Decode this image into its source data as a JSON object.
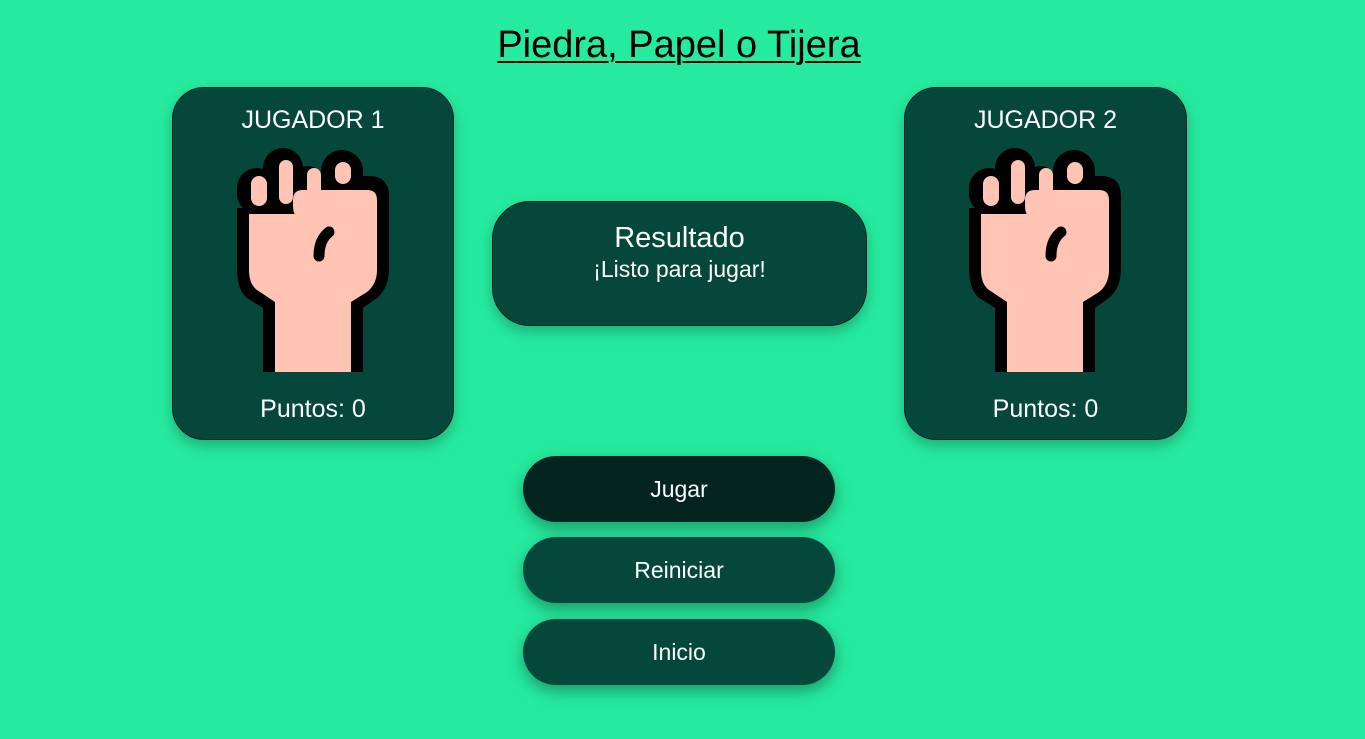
{
  "title": "Piedra, Papel o Tijera",
  "players": [
    {
      "name": "JUGADOR 1",
      "score_text": "Puntos: 0",
      "choice_icon": "fist-icon"
    },
    {
      "name": "JUGADOR 2",
      "score_text": "Puntos: 0",
      "choice_icon": "fist-icon"
    }
  ],
  "result": {
    "title": "Resultado",
    "message": "¡Listo para jugar!"
  },
  "buttons": {
    "play": "Jugar",
    "reset": "Reiniciar",
    "home": "Inicio"
  },
  "colors": {
    "background": "#26eb9f",
    "panel": "#05483b",
    "play_button": "#04241f",
    "skin": "#ffc4b3",
    "text": "#ffffff"
  }
}
